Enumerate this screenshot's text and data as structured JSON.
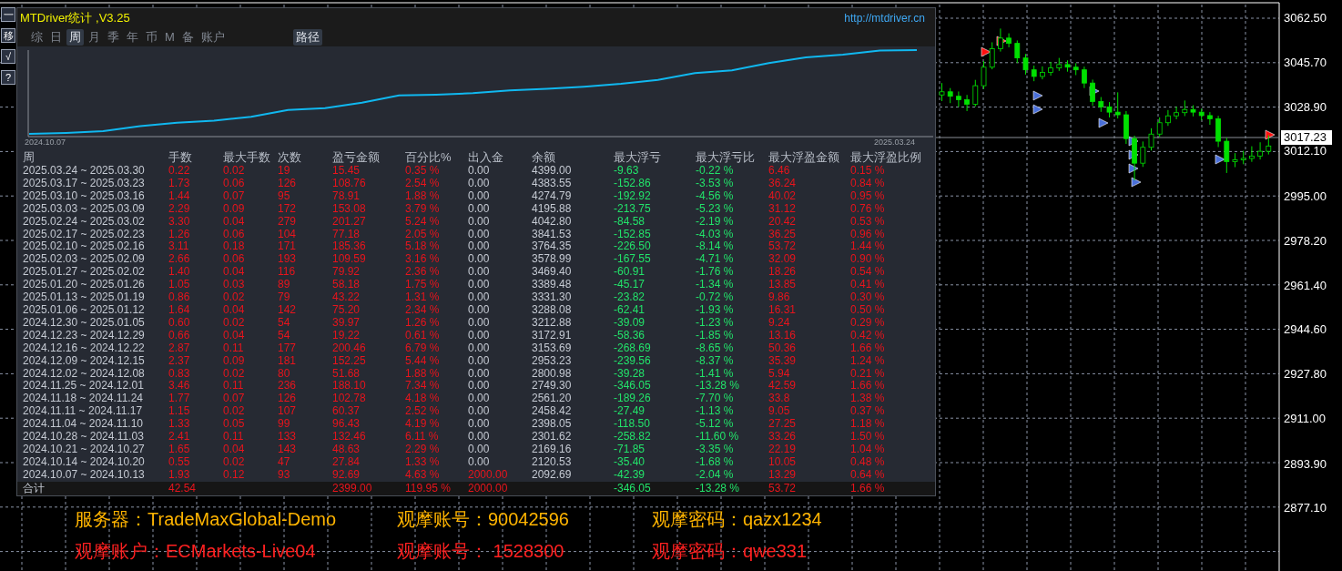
{
  "toolbar": [
    "一",
    "移",
    "√",
    "?"
  ],
  "panel": {
    "title": "MTDriver统计 ,V3.25",
    "link": "http://mtdriver.cn",
    "tabs": [
      {
        "label": "综",
        "selected": false
      },
      {
        "label": "日",
        "selected": false
      },
      {
        "label": "周",
        "selected": true
      },
      {
        "label": "月",
        "selected": false
      },
      {
        "label": "季",
        "selected": false
      },
      {
        "label": "年",
        "selected": false
      },
      {
        "label": "币",
        "selected": false
      },
      {
        "label": "M",
        "selected": false
      },
      {
        "label": "备",
        "selected": false
      },
      {
        "label": "账户",
        "selected": false
      }
    ],
    "path_button": {
      "label": "路径",
      "selected": true
    },
    "chart_start": "2024.10.07",
    "chart_end": "2025.03.24",
    "columns": [
      "周",
      "手数",
      "最大手数",
      "次数",
      "盈亏金额",
      "百分比%",
      "出入金",
      "余额",
      "最大浮亏",
      "最大浮亏比",
      "最大浮盈金额",
      "最大浮盈比例"
    ],
    "rows": [
      {
        "cells": [
          "2025.03.24 ~ 2025.03.30",
          "0.22",
          "0.02",
          "19",
          "15.45",
          "0.35 %",
          "0.00",
          "4399.00",
          "-9.63",
          "-0.22 %",
          "6.46",
          "0.15 %"
        ],
        "cash_in": false
      },
      {
        "cells": [
          "2025.03.17 ~ 2025.03.23",
          "1.73",
          "0.06",
          "126",
          "108.76",
          "2.54 %",
          "0.00",
          "4383.55",
          "-152.86",
          "-3.53 %",
          "36.24",
          "0.84 %"
        ],
        "cash_in": false
      },
      {
        "cells": [
          "2025.03.10 ~ 2025.03.16",
          "1.44",
          "0.07",
          "95",
          "78.91",
          "1.88 %",
          "0.00",
          "4274.79",
          "-192.92",
          "-4.56 %",
          "40.02",
          "0.95 %"
        ],
        "cash_in": false
      },
      {
        "cells": [
          "2025.03.03 ~ 2025.03.09",
          "2.29",
          "0.09",
          "172",
          "153.08",
          "3.79 %",
          "0.00",
          "4195.88",
          "-213.75",
          "-5.23 %",
          "31.12",
          "0.76 %"
        ],
        "cash_in": false
      },
      {
        "cells": [
          "2025.02.24 ~ 2025.03.02",
          "3.30",
          "0.04",
          "279",
          "201.27",
          "5.24 %",
          "0.00",
          "4042.80",
          "-84.58",
          "-2.19 %",
          "20.42",
          "0.53 %"
        ],
        "cash_in": false
      },
      {
        "cells": [
          "2025.02.17 ~ 2025.02.23",
          "1.26",
          "0.06",
          "104",
          "77.18",
          "2.05 %",
          "0.00",
          "3841.53",
          "-152.85",
          "-4.03 %",
          "36.25",
          "0.96 %"
        ],
        "cash_in": false
      },
      {
        "cells": [
          "2025.02.10 ~ 2025.02.16",
          "3.11",
          "0.18",
          "171",
          "185.36",
          "5.18 %",
          "0.00",
          "3764.35",
          "-226.50",
          "-8.14 %",
          "53.72",
          "1.44 %"
        ],
        "cash_in": false
      },
      {
        "cells": [
          "2025.02.03 ~ 2025.02.09",
          "2.66",
          "0.06",
          "193",
          "109.59",
          "3.16 %",
          "0.00",
          "3578.99",
          "-167.55",
          "-4.71 %",
          "32.09",
          "0.90 %"
        ],
        "cash_in": false
      },
      {
        "cells": [
          "2025.01.27 ~ 2025.02.02",
          "1.40",
          "0.04",
          "116",
          "79.92",
          "2.36 %",
          "0.00",
          "3469.40",
          "-60.91",
          "-1.76 %",
          "18.26",
          "0.54 %"
        ],
        "cash_in": false
      },
      {
        "cells": [
          "2025.01.20 ~ 2025.01.26",
          "1.05",
          "0.03",
          "89",
          "58.18",
          "1.75 %",
          "0.00",
          "3389.48",
          "-45.17",
          "-1.34 %",
          "13.85",
          "0.41 %"
        ],
        "cash_in": false
      },
      {
        "cells": [
          "2025.01.13 ~ 2025.01.19",
          "0.86",
          "0.02",
          "79",
          "43.22",
          "1.31 %",
          "0.00",
          "3331.30",
          "-23.82",
          "-0.72 %",
          "9.86",
          "0.30 %"
        ],
        "cash_in": false
      },
      {
        "cells": [
          "2025.01.06 ~ 2025.01.12",
          "1.64",
          "0.04",
          "142",
          "75.20",
          "2.34 %",
          "0.00",
          "3288.08",
          "-62.41",
          "-1.93 %",
          "16.31",
          "0.50 %"
        ],
        "cash_in": false
      },
      {
        "cells": [
          "2024.12.30 ~ 2025.01.05",
          "0.60",
          "0.02",
          "54",
          "39.97",
          "1.26 %",
          "0.00",
          "3212.88",
          "-39.09",
          "-1.23 %",
          "9.24",
          "0.29 %"
        ],
        "cash_in": false
      },
      {
        "cells": [
          "2024.12.23 ~ 2024.12.29",
          "0.66",
          "0.04",
          "54",
          "19.22",
          "0.61 %",
          "0.00",
          "3172.91",
          "-58.36",
          "-1.85 %",
          "13.16",
          "0.42 %"
        ],
        "cash_in": false
      },
      {
        "cells": [
          "2024.12.16 ~ 2024.12.22",
          "2.87",
          "0.11",
          "177",
          "200.46",
          "6.79 %",
          "0.00",
          "3153.69",
          "-268.69",
          "-8.65 %",
          "50.36",
          "1.66 %"
        ],
        "cash_in": false
      },
      {
        "cells": [
          "2024.12.09 ~ 2024.12.15",
          "2.37",
          "0.09",
          "181",
          "152.25",
          "5.44 %",
          "0.00",
          "2953.23",
          "-239.56",
          "-8.37 %",
          "35.39",
          "1.24 %"
        ],
        "cash_in": false
      },
      {
        "cells": [
          "2024.12.02 ~ 2024.12.08",
          "0.83",
          "0.02",
          "80",
          "51.68",
          "1.88 %",
          "0.00",
          "2800.98",
          "-39.28",
          "-1.41 %",
          "5.94",
          "0.21 %"
        ],
        "cash_in": false
      },
      {
        "cells": [
          "2024.11.25 ~ 2024.12.01",
          "3.46",
          "0.11",
          "236",
          "188.10",
          "7.34 %",
          "0.00",
          "2749.30",
          "-346.05",
          "-13.28 %",
          "42.59",
          "1.66 %"
        ],
        "cash_in": false
      },
      {
        "cells": [
          "2024.11.18 ~ 2024.11.24",
          "1.77",
          "0.07",
          "126",
          "102.78",
          "4.18 %",
          "0.00",
          "2561.20",
          "-189.26",
          "-7.70 %",
          "33.8",
          "1.38 %"
        ],
        "cash_in": false
      },
      {
        "cells": [
          "2024.11.11 ~ 2024.11.17",
          "1.15",
          "0.02",
          "107",
          "60.37",
          "2.52 %",
          "0.00",
          "2458.42",
          "-27.49",
          "-1.13 %",
          "9.05",
          "0.37 %"
        ],
        "cash_in": false
      },
      {
        "cells": [
          "2024.11.04 ~ 2024.11.10",
          "1.33",
          "0.05",
          "99",
          "96.43",
          "4.19 %",
          "0.00",
          "2398.05",
          "-118.50",
          "-5.12 %",
          "27.25",
          "1.18 %"
        ],
        "cash_in": false
      },
      {
        "cells": [
          "2024.10.28 ~ 2024.11.03",
          "2.41",
          "0.11",
          "133",
          "132.46",
          "6.11 %",
          "0.00",
          "2301.62",
          "-258.82",
          "-11.60 %",
          "33.26",
          "1.50 %"
        ],
        "cash_in": false
      },
      {
        "cells": [
          "2024.10.21 ~ 2024.10.27",
          "1.65",
          "0.04",
          "143",
          "48.63",
          "2.29 %",
          "0.00",
          "2169.16",
          "-71.85",
          "-3.35 %",
          "22.19",
          "1.04 %"
        ],
        "cash_in": false
      },
      {
        "cells": [
          "2024.10.14 ~ 2024.10.20",
          "0.55",
          "0.02",
          "47",
          "27.84",
          "1.33 %",
          "0.00",
          "2120.53",
          "-35.40",
          "-1.68 %",
          "10.05",
          "0.48 %"
        ],
        "cash_in": false
      },
      {
        "cells": [
          "2024.10.07 ~ 2024.10.13",
          "1.93",
          "0.12",
          "93",
          "92.69",
          "4.63 %",
          "2000.00",
          "2092.69",
          "-42.39",
          "-2.04 %",
          "13.29",
          "0.64 %"
        ],
        "cash_in": true
      }
    ],
    "total": {
      "label": "合计",
      "lots": "42.54",
      "pnl": "2399.00",
      "pct": "119.95 %",
      "cash": "2000.00",
      "max_float_loss": "-346.05",
      "max_float_loss_pct": "-13.28 %",
      "max_float_profit": "53.72",
      "max_float_profit_pct": "1.66 %"
    }
  },
  "price_chart": {
    "current": "3017.23",
    "chart_data": {
      "type": "candlestick",
      "ylim": [
        2853.5,
        3069.4
      ],
      "ohlc": [
        [
          3033.5,
          3038.0,
          3031.2,
          3034.7
        ],
        [
          3034.7,
          3036.1,
          3030.4,
          3033.0
        ],
        [
          3033.0,
          3034.8,
          3029.0,
          3031.7
        ],
        [
          3031.7,
          3033.5,
          3027.4,
          3030.0
        ],
        [
          3030.0,
          3039.2,
          3029.1,
          3037.0
        ],
        [
          3037.0,
          3046.3,
          3035.8,
          3044.0
        ],
        [
          3044.0,
          3053.4,
          3043.2,
          3051.0
        ],
        [
          3051.0,
          3058.6,
          3049.9,
          3055.0
        ],
        [
          3055.0,
          3056.8,
          3051.5,
          3053.0
        ],
        [
          3053.0,
          3054.1,
          3045.6,
          3047.5
        ],
        [
          3047.5,
          3049.0,
          3041.2,
          3043.0
        ],
        [
          3043.0,
          3044.6,
          3038.7,
          3040.5
        ],
        [
          3040.5,
          3044.3,
          3039.4,
          3042.0
        ],
        [
          3042.0,
          3046.0,
          3040.8,
          3043.7
        ],
        [
          3043.7,
          3047.5,
          3042.6,
          3045.0
        ],
        [
          3045.0,
          3046.6,
          3042.3,
          3044.0
        ],
        [
          3044.0,
          3045.5,
          3041.0,
          3043.0
        ],
        [
          3043.0,
          3044.2,
          3036.1,
          3038.0
        ],
        [
          3038.0,
          3039.3,
          3029.4,
          3031.0
        ],
        [
          3031.0,
          3032.7,
          3027.1,
          3029.0
        ],
        [
          3029.0,
          3030.8,
          3025.0,
          3027.0
        ],
        [
          3027.0,
          3034.5,
          3024.6,
          3026.0
        ],
        [
          3026.0,
          3027.4,
          3015.0,
          3017.0
        ],
        [
          3017.0,
          3018.1,
          3001.2,
          3007.7
        ],
        [
          3007.7,
          3015.9,
          3006.3,
          3013.7
        ],
        [
          3013.7,
          3020.9,
          3012.5,
          3018.7
        ],
        [
          3018.7,
          3025.0,
          3017.6,
          3023.0
        ],
        [
          3023.0,
          3027.8,
          3021.8,
          3025.6
        ],
        [
          3025.6,
          3029.1,
          3024.3,
          3026.8
        ],
        [
          3026.8,
          3031.4,
          3025.5,
          3028.0
        ],
        [
          3028.0,
          3029.6,
          3025.4,
          3027.0
        ],
        [
          3027.0,
          3028.3,
          3023.9,
          3025.7
        ],
        [
          3025.7,
          3027.0,
          3022.2,
          3024.5
        ],
        [
          3024.5,
          3025.6,
          3013.8,
          3016.0
        ],
        [
          3016.0,
          3017.3,
          3004.0,
          3008.3
        ],
        [
          3008.3,
          3011.5,
          3006.2,
          3009.0
        ],
        [
          3009.0,
          3012.4,
          3007.3,
          3009.5
        ],
        [
          3009.5,
          3014.1,
          3008.2,
          3010.4
        ],
        [
          3010.4,
          3015.6,
          3009.1,
          3012.2
        ],
        [
          3012.2,
          3018.3,
          3011.0,
          3014.2
        ]
      ],
      "yticks": [
        {
          "value": 3062.5,
          "label": "3062.50"
        },
        {
          "value": 3045.7,
          "label": "3045.70"
        },
        {
          "value": 3028.9,
          "label": "3028.90"
        },
        {
          "value": 3012.1,
          "label": "3012.10"
        },
        {
          "value": 2995.0,
          "label": "2995.00"
        },
        {
          "value": 2978.2,
          "label": "2978.20"
        },
        {
          "value": 2961.4,
          "label": "2961.40"
        },
        {
          "value": 2944.6,
          "label": "2944.60"
        },
        {
          "value": 2927.8,
          "label": "2927.80"
        },
        {
          "value": 2911.0,
          "label": "2911.00"
        },
        {
          "value": 2893.9,
          "label": "2893.90"
        },
        {
          "value": 2877.1,
          "label": "2877.10"
        }
      ]
    }
  },
  "notes": [
    {
      "color": "#ffb400",
      "items": [
        "服务器：TradeMaxGlobal-Demo",
        "观摩账号：90042596",
        "观摩密码：qazx1234"
      ]
    },
    {
      "color": "#ff2020",
      "items": [
        "观摩账户：ECMarkets-Live04",
        "观摩账号： 1528300",
        "观摩密码：qwe331"
      ]
    }
  ]
}
